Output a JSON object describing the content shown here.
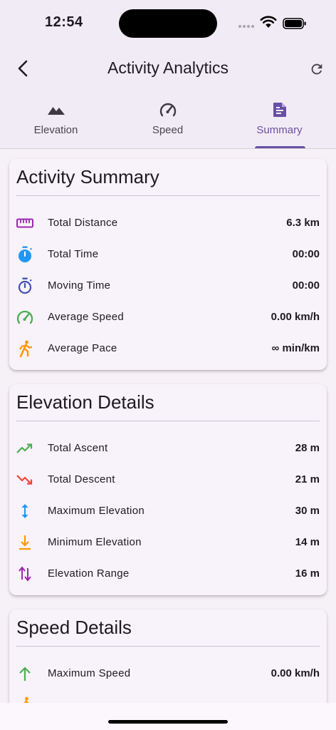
{
  "status_bar": {
    "time": "12:54"
  },
  "app_bar": {
    "title": "Activity Analytics"
  },
  "tabs": [
    {
      "label": "Elevation",
      "icon": "terrain-icon",
      "active": false
    },
    {
      "label": "Speed",
      "icon": "speedometer-icon",
      "active": false
    },
    {
      "label": "Summary",
      "icon": "summary-document-icon",
      "active": true
    }
  ],
  "colors": {
    "accent": "#6750a4",
    "purple": "#9c27b0",
    "blue": "#2196f3",
    "indigo": "#3f51b5",
    "green": "#4caf50",
    "orange": "#ff9800",
    "red": "#f44336"
  },
  "activity_summary": {
    "title": "Activity Summary",
    "rows": [
      {
        "label": "Total Distance",
        "value": "6.3 km",
        "icon": "ruler-icon"
      },
      {
        "label": "Total Time",
        "value": "00:00",
        "icon": "timer-icon"
      },
      {
        "label": "Moving Time",
        "value": "00:00",
        "icon": "timer-outline-icon"
      },
      {
        "label": "Average Speed",
        "value": "0.00 km/h",
        "icon": "speedometer-icon"
      },
      {
        "label": "Average Pace",
        "value": "∞ min/km",
        "icon": "running-person-icon"
      }
    ]
  },
  "elevation_details": {
    "title": "Elevation Details",
    "rows": [
      {
        "label": "Total Ascent",
        "value": "28 m",
        "icon": "trending-up-icon"
      },
      {
        "label": "Total Descent",
        "value": "21 m",
        "icon": "trending-down-icon"
      },
      {
        "label": "Maximum Elevation",
        "value": "30 m",
        "icon": "height-arrows-icon"
      },
      {
        "label": "Minimum Elevation",
        "value": "14 m",
        "icon": "arrow-down-to-line-icon"
      },
      {
        "label": "Elevation Range",
        "value": "16 m",
        "icon": "swap-vertical-icon"
      }
    ]
  },
  "speed_details": {
    "title": "Speed Details",
    "rows": [
      {
        "label": "Maximum Speed",
        "value": "0.00 km/h",
        "icon": "arrow-up-icon"
      }
    ]
  }
}
